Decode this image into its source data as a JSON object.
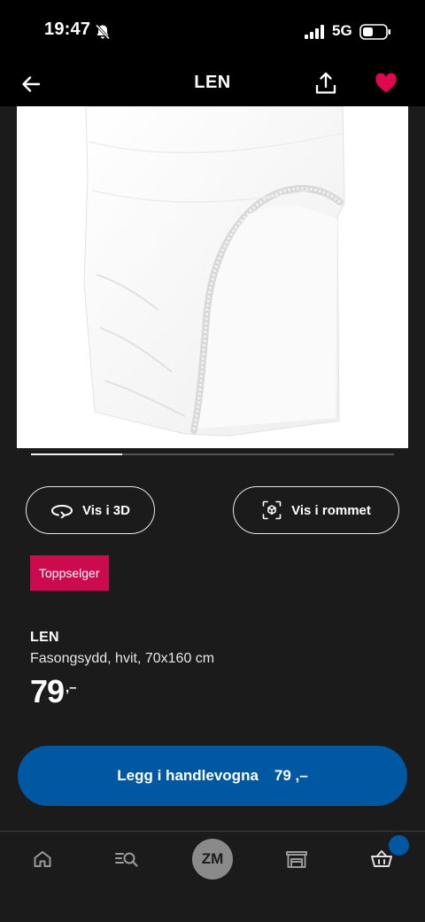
{
  "status_bar": {
    "time": "19:47",
    "network": "5G",
    "icons": [
      "bell-slash-icon",
      "signal-icon",
      "battery-icon"
    ]
  },
  "nav": {
    "title": "LEN",
    "icons": [
      "arrow-left-icon",
      "share-icon",
      "heart-icon"
    ],
    "favorite_color": "#e00751"
  },
  "gallery": {
    "image": "white fitted sheet",
    "progress": 0.25
  },
  "actions": {
    "view_3d_label": "Vis i 3D",
    "view_room_label": "Vis i rommet",
    "icons": [
      "rotate-3d-icon",
      "ar-cube-icon"
    ]
  },
  "badge": {
    "label": "Toppselger",
    "color": "#cc0a4e"
  },
  "product": {
    "name": "LEN",
    "description": "Fasongsydd, hvit, 70x160 cm",
    "price": "79",
    "price_suffix": ",–"
  },
  "cart_button": {
    "label": "Legg i handlevogna",
    "price": "79 ,–",
    "color": "#0058a3"
  },
  "tab_bar": {
    "profile_initials": "ZM",
    "icons": [
      "home-icon",
      "search-list-icon",
      "profile-avatar",
      "store-icon",
      "cart-icon"
    ]
  }
}
